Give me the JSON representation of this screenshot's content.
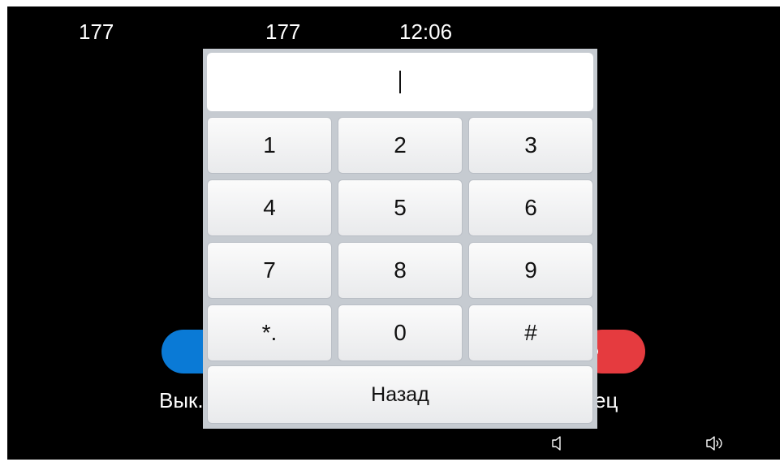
{
  "status": {
    "left_number": "177",
    "center_number": "177",
    "time": "12:06"
  },
  "background_actions": {
    "left_label": "Вык.",
    "right_label": "ец"
  },
  "keypad": {
    "input_value": "",
    "keys": [
      "1",
      "2",
      "3",
      "4",
      "5",
      "6",
      "7",
      "8",
      "9",
      "*.",
      "0",
      "#"
    ],
    "back_label": "Назад"
  },
  "icons": {
    "left": "speaker-icon",
    "right": "speaker-volume-icon"
  },
  "colors": {
    "left_button": "#0a7ad6",
    "right_button": "#e53b3f"
  }
}
